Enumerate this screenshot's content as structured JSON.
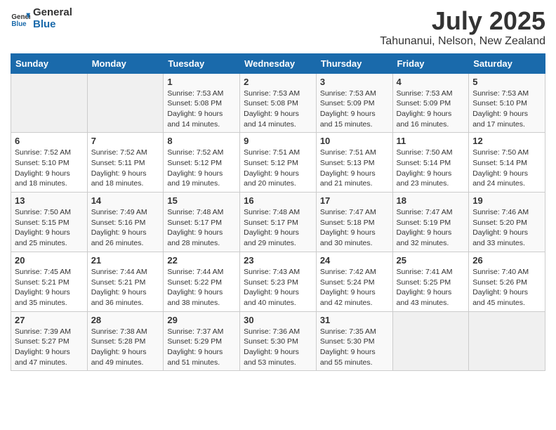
{
  "logo": {
    "general": "General",
    "blue": "Blue"
  },
  "title": "July 2025",
  "subtitle": "Tahunanui, Nelson, New Zealand",
  "weekdays": [
    "Sunday",
    "Monday",
    "Tuesday",
    "Wednesday",
    "Thursday",
    "Friday",
    "Saturday"
  ],
  "weeks": [
    [
      {
        "day": "",
        "empty": true
      },
      {
        "day": "",
        "empty": true
      },
      {
        "day": "1",
        "sunrise": "7:53 AM",
        "sunset": "5:08 PM",
        "daylight": "9 hours and 14 minutes."
      },
      {
        "day": "2",
        "sunrise": "7:53 AM",
        "sunset": "5:08 PM",
        "daylight": "9 hours and 14 minutes."
      },
      {
        "day": "3",
        "sunrise": "7:53 AM",
        "sunset": "5:09 PM",
        "daylight": "9 hours and 15 minutes."
      },
      {
        "day": "4",
        "sunrise": "7:53 AM",
        "sunset": "5:09 PM",
        "daylight": "9 hours and 16 minutes."
      },
      {
        "day": "5",
        "sunrise": "7:53 AM",
        "sunset": "5:10 PM",
        "daylight": "9 hours and 17 minutes."
      }
    ],
    [
      {
        "day": "6",
        "sunrise": "7:52 AM",
        "sunset": "5:10 PM",
        "daylight": "9 hours and 18 minutes."
      },
      {
        "day": "7",
        "sunrise": "7:52 AM",
        "sunset": "5:11 PM",
        "daylight": "9 hours and 18 minutes."
      },
      {
        "day": "8",
        "sunrise": "7:52 AM",
        "sunset": "5:12 PM",
        "daylight": "9 hours and 19 minutes."
      },
      {
        "day": "9",
        "sunrise": "7:51 AM",
        "sunset": "5:12 PM",
        "daylight": "9 hours and 20 minutes."
      },
      {
        "day": "10",
        "sunrise": "7:51 AM",
        "sunset": "5:13 PM",
        "daylight": "9 hours and 21 minutes."
      },
      {
        "day": "11",
        "sunrise": "7:50 AM",
        "sunset": "5:14 PM",
        "daylight": "9 hours and 23 minutes."
      },
      {
        "day": "12",
        "sunrise": "7:50 AM",
        "sunset": "5:14 PM",
        "daylight": "9 hours and 24 minutes."
      }
    ],
    [
      {
        "day": "13",
        "sunrise": "7:50 AM",
        "sunset": "5:15 PM",
        "daylight": "9 hours and 25 minutes."
      },
      {
        "day": "14",
        "sunrise": "7:49 AM",
        "sunset": "5:16 PM",
        "daylight": "9 hours and 26 minutes."
      },
      {
        "day": "15",
        "sunrise": "7:48 AM",
        "sunset": "5:17 PM",
        "daylight": "9 hours and 28 minutes."
      },
      {
        "day": "16",
        "sunrise": "7:48 AM",
        "sunset": "5:17 PM",
        "daylight": "9 hours and 29 minutes."
      },
      {
        "day": "17",
        "sunrise": "7:47 AM",
        "sunset": "5:18 PM",
        "daylight": "9 hours and 30 minutes."
      },
      {
        "day": "18",
        "sunrise": "7:47 AM",
        "sunset": "5:19 PM",
        "daylight": "9 hours and 32 minutes."
      },
      {
        "day": "19",
        "sunrise": "7:46 AM",
        "sunset": "5:20 PM",
        "daylight": "9 hours and 33 minutes."
      }
    ],
    [
      {
        "day": "20",
        "sunrise": "7:45 AM",
        "sunset": "5:21 PM",
        "daylight": "9 hours and 35 minutes."
      },
      {
        "day": "21",
        "sunrise": "7:44 AM",
        "sunset": "5:21 PM",
        "daylight": "9 hours and 36 minutes."
      },
      {
        "day": "22",
        "sunrise": "7:44 AM",
        "sunset": "5:22 PM",
        "daylight": "9 hours and 38 minutes."
      },
      {
        "day": "23",
        "sunrise": "7:43 AM",
        "sunset": "5:23 PM",
        "daylight": "9 hours and 40 minutes."
      },
      {
        "day": "24",
        "sunrise": "7:42 AM",
        "sunset": "5:24 PM",
        "daylight": "9 hours and 42 minutes."
      },
      {
        "day": "25",
        "sunrise": "7:41 AM",
        "sunset": "5:25 PM",
        "daylight": "9 hours and 43 minutes."
      },
      {
        "day": "26",
        "sunrise": "7:40 AM",
        "sunset": "5:26 PM",
        "daylight": "9 hours and 45 minutes."
      }
    ],
    [
      {
        "day": "27",
        "sunrise": "7:39 AM",
        "sunset": "5:27 PM",
        "daylight": "9 hours and 47 minutes."
      },
      {
        "day": "28",
        "sunrise": "7:38 AM",
        "sunset": "5:28 PM",
        "daylight": "9 hours and 49 minutes."
      },
      {
        "day": "29",
        "sunrise": "7:37 AM",
        "sunset": "5:29 PM",
        "daylight": "9 hours and 51 minutes."
      },
      {
        "day": "30",
        "sunrise": "7:36 AM",
        "sunset": "5:30 PM",
        "daylight": "9 hours and 53 minutes."
      },
      {
        "day": "31",
        "sunrise": "7:35 AM",
        "sunset": "5:30 PM",
        "daylight": "9 hours and 55 minutes."
      },
      {
        "day": "",
        "empty": true
      },
      {
        "day": "",
        "empty": true
      }
    ]
  ]
}
